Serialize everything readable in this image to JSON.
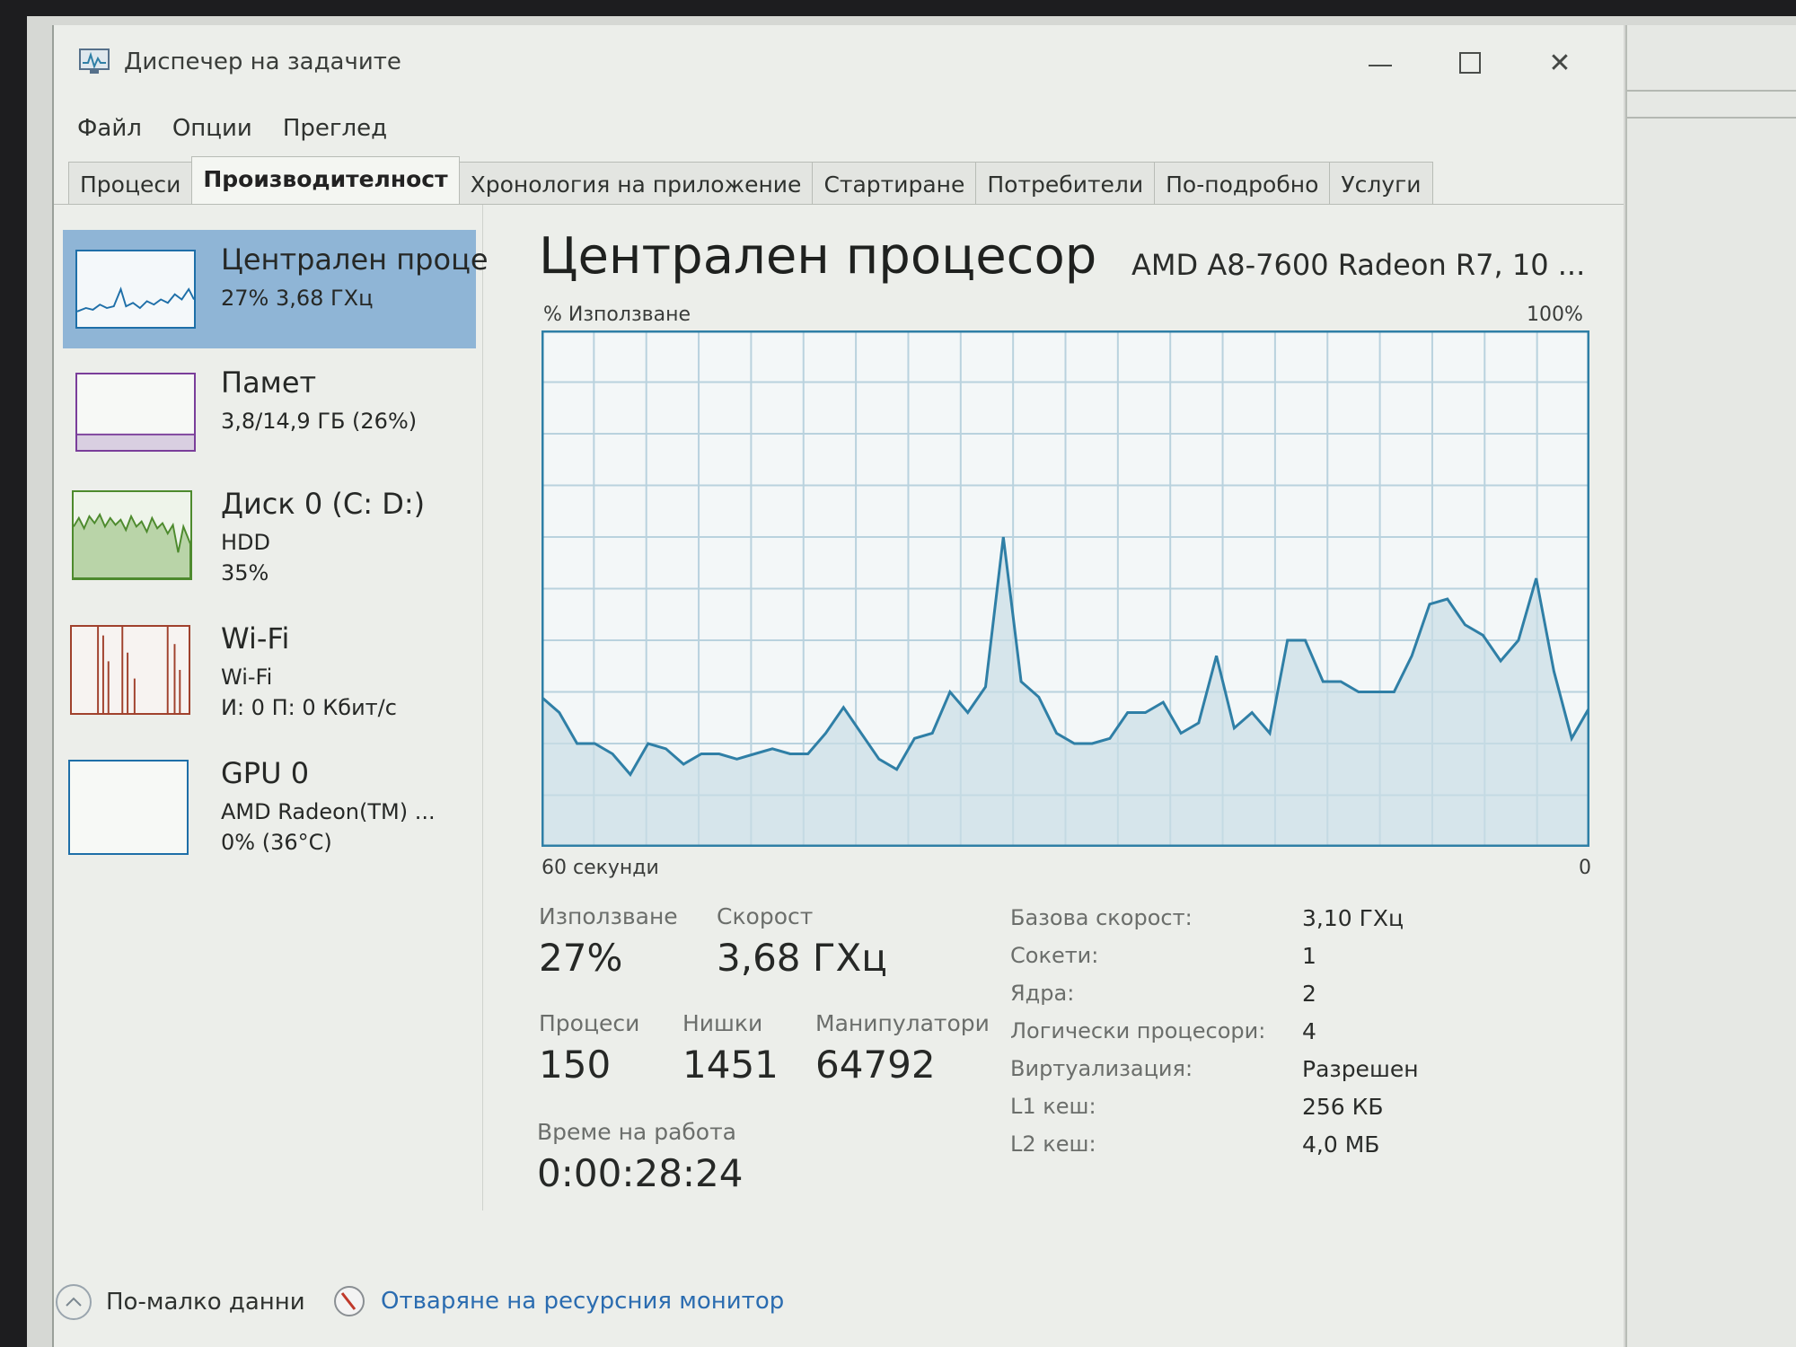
{
  "window": {
    "title": "Диспечер на задачите"
  },
  "menu": [
    "Файл",
    "Опции",
    "Преглед"
  ],
  "tabs": [
    "Процеси",
    "Производителност",
    "Хронология на приложение",
    "Стартиране",
    "Потребители",
    "По-подробно",
    "Услуги"
  ],
  "sidebar": {
    "items": [
      {
        "title": "Централен проце",
        "line1": "27%  3,68 ГХц",
        "line2": "",
        "line3": "",
        "color": "#1e6fa8"
      },
      {
        "title": "Памет",
        "line1": "3,8/14,9 ГБ (26%)",
        "line2": "",
        "line3": "",
        "color": "#7a3e9a"
      },
      {
        "title": "Диск 0 (C: D:)",
        "line1": "HDD",
        "line2": "35%",
        "line3": "",
        "color": "#4d8a2d"
      },
      {
        "title": "Wi-Fi",
        "line1": "Wi-Fi",
        "line2": "И: 0 П: 0 Кбит/с",
        "line3": "",
        "color": "#a0412d"
      },
      {
        "title": "GPU 0",
        "line1": "AMD Radeon(TM) ...",
        "line2": "0%  (36°C)",
        "line3": "",
        "color": "#1e6fa8"
      }
    ]
  },
  "main": {
    "title": "Централен процесор",
    "model": "AMD A8-7600 Radeon R7, 10 ...",
    "graph_label_left": "% Използване",
    "graph_label_right": "100%",
    "axis_left": "60 секунди",
    "axis_right": "0",
    "stats": {
      "usage_label": "Използване",
      "usage_value": "27%",
      "speed_label": "Скорост",
      "speed_value": "3,68 ГХц",
      "processes_label": "Процеси",
      "processes_value": "150",
      "threads_label": "Нишки",
      "threads_value": "1451",
      "handles_label": "Манипулатори",
      "handles_value": "64792",
      "uptime_label": "Време на работа",
      "uptime_value": "0:00:28:24"
    },
    "details": [
      {
        "key": "Базова скорост:",
        "value": "3,10 ГХц"
      },
      {
        "key": "Сокети:",
        "value": "1"
      },
      {
        "key": "Ядра:",
        "value": "2"
      },
      {
        "key": "Логически процесори:",
        "value": "4"
      },
      {
        "key": "Виртуализация:",
        "value": "Разрешен"
      },
      {
        "key": "L1 кеш:",
        "value": "256 КБ"
      },
      {
        "key": "L2 кеш:",
        "value": "4,0 МБ"
      }
    ]
  },
  "footer": {
    "fewer_details": "По-малко данни",
    "open_monitor": "Отваряне на ресурсния монитор"
  },
  "colors": {
    "accent": "#1e6fa8",
    "graph_line": "#2f7fa6",
    "graph_fill": "#c9dde6",
    "graph_grid": "#b9d2de",
    "link": "#2b6cb0"
  },
  "cpu_history": {
    "unit": "%",
    "values": [
      29,
      26,
      20,
      20,
      18,
      14,
      20,
      19,
      16,
      18,
      18,
      17,
      18,
      19,
      18,
      18,
      22,
      27,
      22,
      17,
      15,
      21,
      22,
      30,
      26,
      31,
      60,
      32,
      29,
      22,
      20,
      20,
      21,
      26,
      26,
      28,
      22,
      24,
      37,
      23,
      26,
      22,
      40,
      40,
      32,
      32,
      30,
      30,
      30,
      37,
      47,
      48,
      43,
      41,
      36,
      40,
      52,
      34,
      21,
      27
    ]
  }
}
